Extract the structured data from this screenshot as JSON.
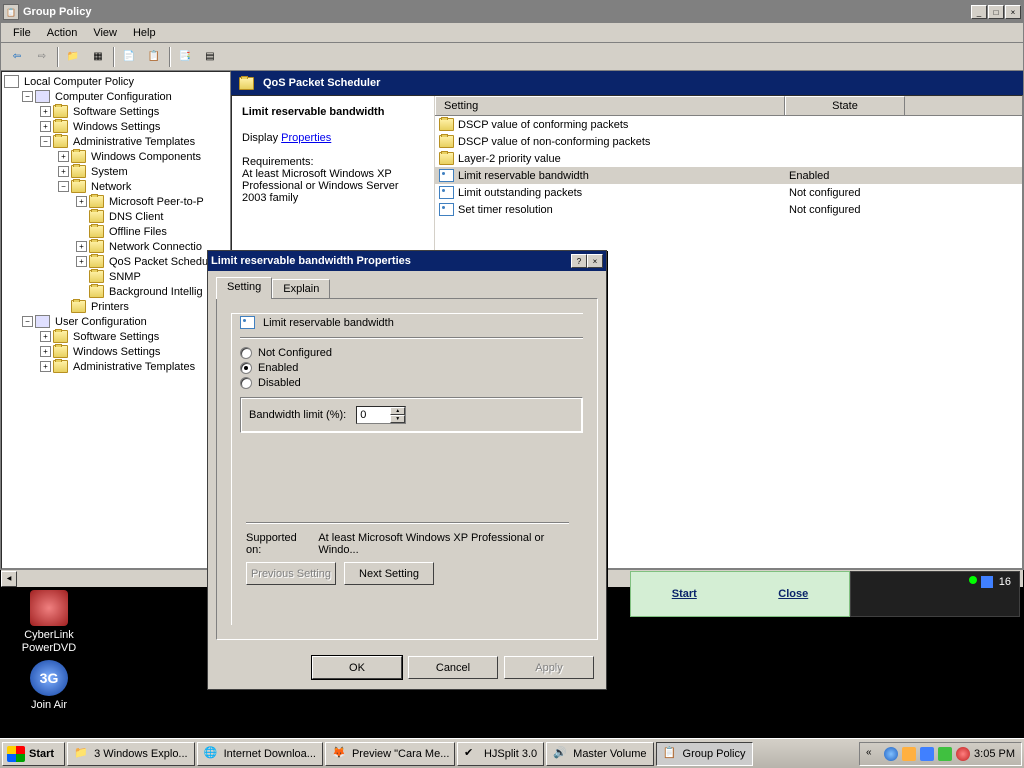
{
  "window": {
    "title": "Group Policy",
    "menus": [
      "File",
      "Action",
      "View",
      "Help"
    ]
  },
  "tree": {
    "root": "Local Computer Policy",
    "computercfg": "Computer Configuration",
    "software": "Software Settings",
    "windows": "Windows Settings",
    "admin": "Administrative Templates",
    "wincomp": "Windows Components",
    "system": "System",
    "network": "Network",
    "msp2p": "Microsoft Peer-to-P",
    "dnsclient": "DNS Client",
    "offline": "Offline Files",
    "netconn": "Network Connectio",
    "qos": "QoS Packet Schedu",
    "snmp": "SNMP",
    "bits": "Background Intellig",
    "printers": "Printers",
    "usercfg": "User Configuration",
    "u_software": "Software Settings",
    "u_windows": "Windows Settings",
    "u_admin": "Administrative Templates"
  },
  "right": {
    "header": "QoS Packet Scheduler",
    "info_title": "Limit reservable bandwidth",
    "display": "Display",
    "properties": "Properties",
    "req_label": "Requirements:",
    "req_text": "At least Microsoft Windows XP Professional or Windows Server 2003 family",
    "col_setting": "Setting",
    "col_state": "State",
    "rows": [
      {
        "name": "DSCP value of conforming packets",
        "state": "",
        "icon": "folder"
      },
      {
        "name": "DSCP value of non-conforming packets",
        "state": "",
        "icon": "folder"
      },
      {
        "name": "Layer-2 priority value",
        "state": "",
        "icon": "folder"
      },
      {
        "name": "Limit reservable bandwidth",
        "state": "Enabled",
        "icon": "setting",
        "selected": true
      },
      {
        "name": "Limit outstanding packets",
        "state": "Not configured",
        "icon": "setting"
      },
      {
        "name": "Set timer resolution",
        "state": "Not configured",
        "icon": "setting"
      }
    ]
  },
  "dialog": {
    "title": "Limit reservable bandwidth Properties",
    "tabs": [
      "Setting",
      "Explain"
    ],
    "heading": "Limit reservable bandwidth",
    "radios": {
      "notconf": "Not Configured",
      "enabled": "Enabled",
      "disabled": "Disabled"
    },
    "selected": "enabled",
    "field_label": "Bandwidth limit (%):",
    "field_value": "0",
    "supported_label": "Supported on:",
    "supported_text": "At least Microsoft Windows XP Professional or Windo...",
    "prev_btn": "Previous Setting",
    "next_btn": "Next Setting",
    "ok": "OK",
    "cancel": "Cancel",
    "apply": "Apply"
  },
  "strip": {
    "start": "Start",
    "close": "Close",
    "badge": "16"
  },
  "desktop": {
    "icon1": "CyberLink PowerDVD",
    "icon2": "Join Air"
  },
  "taskbar": {
    "start": "Start",
    "tasks": [
      {
        "label": "3 Windows Explo..."
      },
      {
        "label": "Internet Downloa..."
      },
      {
        "label": "Preview \"Cara Me..."
      },
      {
        "label": "HJSplit 3.0"
      },
      {
        "label": "Master Volume"
      },
      {
        "label": "Group Policy",
        "active": true
      }
    ],
    "time": "3:05 PM"
  }
}
